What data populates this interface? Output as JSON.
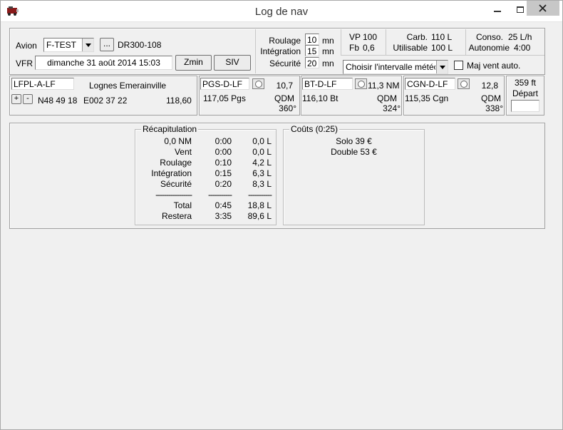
{
  "window": {
    "title": "Log de nav"
  },
  "aircraft": {
    "label": "Avion",
    "selected": "F-TEST",
    "browse_label": "...",
    "model": "DR300-108"
  },
  "flight": {
    "rules_label": "VFR",
    "date": "dimanche 31 août 2014 15:03",
    "zmin_label": "Zmin",
    "siv_label": "SIV"
  },
  "timings": {
    "rows": [
      {
        "label": "Roulage",
        "value": "10",
        "unit": "mn"
      },
      {
        "label": "Intégration",
        "value": "15",
        "unit": "mn"
      },
      {
        "label": "Sécurité",
        "value": "20",
        "unit": "mn"
      }
    ]
  },
  "perf": {
    "vp_label": "VP",
    "vp_value": "100",
    "fb_label": "Fb",
    "fb_value": "0,6",
    "carb_label": "Carb.",
    "carb_value": "110 L",
    "usable_label": "Utilisable",
    "usable_value": "100 L",
    "conso_label": "Conso.",
    "conso_value": "25 L/h",
    "autonomy_label": "Autonomie",
    "autonomy_value": "4:00"
  },
  "meteo": {
    "interval_placeholder": "Choisir l'intervalle météo",
    "auto_wind_label": "Maj vent auto.",
    "auto_wind_checked": false
  },
  "departure": {
    "code": "LFPL-A-LF",
    "name": "Lognes Emerainville",
    "add_label": "+",
    "remove_label": "-",
    "lat": "N48 49 18",
    "lon": "E002 37 22",
    "freq": "118,60"
  },
  "legs": [
    {
      "code": "PGS-D-LF",
      "distance": "10,7",
      "freq": "117,05 Pgs",
      "qdm_label": "QDM",
      "qdm": "360°"
    },
    {
      "code": "BT-D-LF",
      "distance": "11,3 NM",
      "freq": "116,10 Bt",
      "qdm_label": "QDM",
      "qdm": "324°"
    },
    {
      "code": "CGN-D-LF",
      "distance": "12,8",
      "freq": "115,35 Cgn",
      "qdm_label": "QDM",
      "qdm": "338°"
    }
  ],
  "altitude": {
    "value": "359 ft",
    "label": "Départ",
    "input": ""
  },
  "recap": {
    "title": "Récapitulation",
    "rows": [
      {
        "label": "0,0 NM",
        "time": "0:00",
        "fuel": "0,0 L"
      },
      {
        "label": "Vent",
        "time": "0:00",
        "fuel": "0,0 L"
      },
      {
        "label": "Roulage",
        "time": "0:10",
        "fuel": "4,2 L"
      },
      {
        "label": "Intégration",
        "time": "0:15",
        "fuel": "6,3 L"
      },
      {
        "label": "Sécurité",
        "time": "0:20",
        "fuel": "8,3 L"
      }
    ],
    "separator": {
      "label": "-----------------",
      "time": "-----------",
      "fuel": "-----------"
    },
    "total": {
      "label": "Total",
      "time": "0:45",
      "fuel": "18,8 L"
    },
    "remaining": {
      "label": "Restera",
      "time": "3:35",
      "fuel": "89,6 L"
    }
  },
  "costs": {
    "title": "Coûts (0:25)",
    "solo": "Solo 39 €",
    "double": "Double 53 €"
  },
  "colors": {
    "window_bg": "#f0f0f0",
    "close_hover": "#c7c7c7"
  }
}
